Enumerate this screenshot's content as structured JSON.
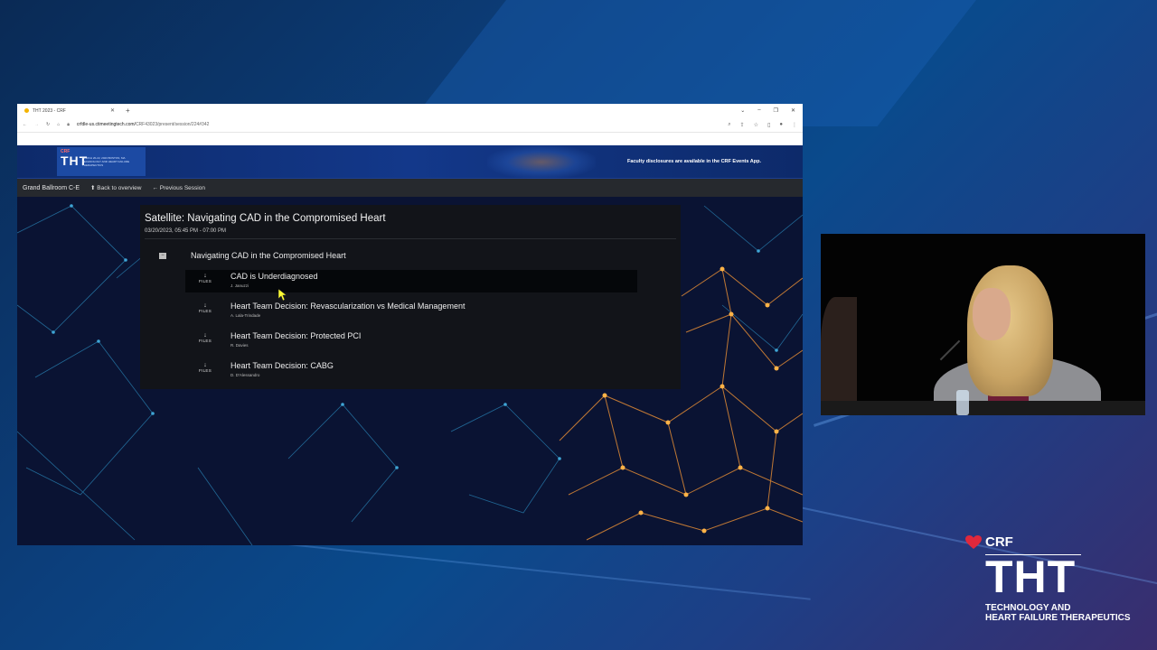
{
  "browser": {
    "tab_title": "THT 2023 - CRF",
    "url_prefix": "crfdle-us.ctimeetingtech.com/",
    "url_path": "CRF43023/present/session/224#342"
  },
  "banner": {
    "brand_small": "CRF",
    "logo_text": "THT",
    "logo_subtitle": "TECHNOLOGY AND HEART FAILURE THERAPEUTICS",
    "logo_dates": "MARCH 20-22, 2023 BOSTON, MA",
    "note": "Faculty disclosures are available in the CRF Events App."
  },
  "nav": {
    "room": "Grand Ballroom C-E",
    "back_to_overview": "Back to overview",
    "previous_session": "Previous Session"
  },
  "session": {
    "title": "Satellite: Navigating CAD in the Compromised Heart",
    "time": "03/20/2023, 05:45 PM - 07:00 PM",
    "topic_title": "Navigating CAD in the Compromised Heart",
    "toggle_symbol": "−",
    "talks": [
      {
        "title": "CAD is Underdiagnosed",
        "author": "J. Januzzi",
        "files_label": "FILES",
        "files_arrow": "↓"
      },
      {
        "title": "Heart Team Decision: Revascularization vs Medical Management",
        "author": "A. Lala-Trindade",
        "files_label": "FILES",
        "files_arrow": "↓"
      },
      {
        "title": "Heart Team Decision: Protected PCI",
        "author": "R. Davies",
        "files_label": "FILES",
        "files_arrow": "↓"
      },
      {
        "title": "Heart Team Decision: CABG",
        "author": "D. D'Alessandro",
        "files_label": "FILES",
        "files_arrow": "↓"
      }
    ]
  },
  "brand": {
    "crf": "CRF",
    "tht": "THT",
    "line1": "TECHNOLOGY AND",
    "line2": "HEART FAILURE THERAPEUTICS"
  },
  "colors": {
    "accent_red": "#e0283c",
    "page_bg": "#0a1333",
    "panel_bg": "#121419",
    "network_orange": "#f0a040"
  }
}
